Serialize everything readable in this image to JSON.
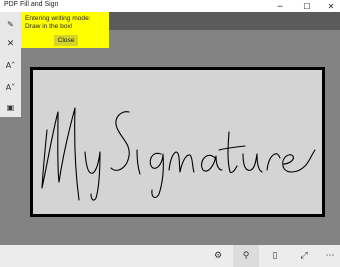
{
  "window": {
    "title": "PDF Fill and Sign",
    "minimize_glyph": "─",
    "maximize_glyph": "☐",
    "close_glyph": "✕"
  },
  "left_toolbar": {
    "items": [
      {
        "icon": "pen-icon",
        "glyph": "✎"
      },
      {
        "icon": "close-icon",
        "glyph": "✕"
      },
      {
        "icon": "font-increase-icon",
        "glyph": "A˄"
      },
      {
        "icon": "font-decrease-icon",
        "glyph": "A˅"
      },
      {
        "icon": "save-icon",
        "glyph": "▣"
      }
    ]
  },
  "notice": {
    "message": "Entering writing mode: Draw in the box!",
    "close_label": "Close",
    "background": "#ffff00"
  },
  "signature": {
    "ink_color": "#000000",
    "box_color": "#d4d4d4"
  },
  "bottom_bar": {
    "items": [
      {
        "icon": "settings-gear-icon",
        "glyph": "⚙"
      },
      {
        "icon": "search-icon",
        "glyph": "⚲"
      },
      {
        "icon": "page-icon",
        "glyph": "▯"
      },
      {
        "icon": "fullscreen-icon",
        "glyph": "⤢"
      },
      {
        "icon": "more-icon",
        "glyph": "⋯"
      }
    ]
  }
}
